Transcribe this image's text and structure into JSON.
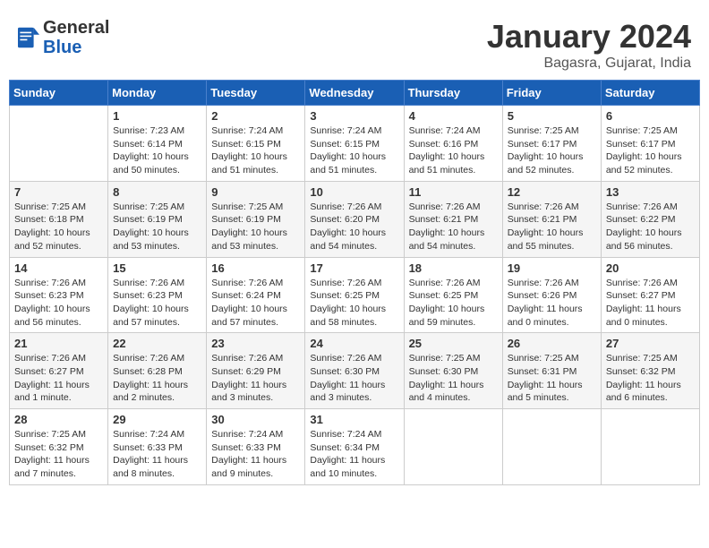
{
  "header": {
    "logo_general": "General",
    "logo_blue": "Blue",
    "month_title": "January 2024",
    "location": "Bagasra, Gujarat, India"
  },
  "days_of_week": [
    "Sunday",
    "Monday",
    "Tuesday",
    "Wednesday",
    "Thursday",
    "Friday",
    "Saturday"
  ],
  "weeks": [
    [
      {
        "num": "",
        "info": ""
      },
      {
        "num": "1",
        "info": "Sunrise: 7:23 AM\nSunset: 6:14 PM\nDaylight: 10 hours\nand 50 minutes."
      },
      {
        "num": "2",
        "info": "Sunrise: 7:24 AM\nSunset: 6:15 PM\nDaylight: 10 hours\nand 51 minutes."
      },
      {
        "num": "3",
        "info": "Sunrise: 7:24 AM\nSunset: 6:15 PM\nDaylight: 10 hours\nand 51 minutes."
      },
      {
        "num": "4",
        "info": "Sunrise: 7:24 AM\nSunset: 6:16 PM\nDaylight: 10 hours\nand 51 minutes."
      },
      {
        "num": "5",
        "info": "Sunrise: 7:25 AM\nSunset: 6:17 PM\nDaylight: 10 hours\nand 52 minutes."
      },
      {
        "num": "6",
        "info": "Sunrise: 7:25 AM\nSunset: 6:17 PM\nDaylight: 10 hours\nand 52 minutes."
      }
    ],
    [
      {
        "num": "7",
        "info": "Sunrise: 7:25 AM\nSunset: 6:18 PM\nDaylight: 10 hours\nand 52 minutes."
      },
      {
        "num": "8",
        "info": "Sunrise: 7:25 AM\nSunset: 6:19 PM\nDaylight: 10 hours\nand 53 minutes."
      },
      {
        "num": "9",
        "info": "Sunrise: 7:25 AM\nSunset: 6:19 PM\nDaylight: 10 hours\nand 53 minutes."
      },
      {
        "num": "10",
        "info": "Sunrise: 7:26 AM\nSunset: 6:20 PM\nDaylight: 10 hours\nand 54 minutes."
      },
      {
        "num": "11",
        "info": "Sunrise: 7:26 AM\nSunset: 6:21 PM\nDaylight: 10 hours\nand 54 minutes."
      },
      {
        "num": "12",
        "info": "Sunrise: 7:26 AM\nSunset: 6:21 PM\nDaylight: 10 hours\nand 55 minutes."
      },
      {
        "num": "13",
        "info": "Sunrise: 7:26 AM\nSunset: 6:22 PM\nDaylight: 10 hours\nand 56 minutes."
      }
    ],
    [
      {
        "num": "14",
        "info": "Sunrise: 7:26 AM\nSunset: 6:23 PM\nDaylight: 10 hours\nand 56 minutes."
      },
      {
        "num": "15",
        "info": "Sunrise: 7:26 AM\nSunset: 6:23 PM\nDaylight: 10 hours\nand 57 minutes."
      },
      {
        "num": "16",
        "info": "Sunrise: 7:26 AM\nSunset: 6:24 PM\nDaylight: 10 hours\nand 57 minutes."
      },
      {
        "num": "17",
        "info": "Sunrise: 7:26 AM\nSunset: 6:25 PM\nDaylight: 10 hours\nand 58 minutes."
      },
      {
        "num": "18",
        "info": "Sunrise: 7:26 AM\nSunset: 6:25 PM\nDaylight: 10 hours\nand 59 minutes."
      },
      {
        "num": "19",
        "info": "Sunrise: 7:26 AM\nSunset: 6:26 PM\nDaylight: 11 hours\nand 0 minutes."
      },
      {
        "num": "20",
        "info": "Sunrise: 7:26 AM\nSunset: 6:27 PM\nDaylight: 11 hours\nand 0 minutes."
      }
    ],
    [
      {
        "num": "21",
        "info": "Sunrise: 7:26 AM\nSunset: 6:27 PM\nDaylight: 11 hours\nand 1 minute."
      },
      {
        "num": "22",
        "info": "Sunrise: 7:26 AM\nSunset: 6:28 PM\nDaylight: 11 hours\nand 2 minutes."
      },
      {
        "num": "23",
        "info": "Sunrise: 7:26 AM\nSunset: 6:29 PM\nDaylight: 11 hours\nand 3 minutes."
      },
      {
        "num": "24",
        "info": "Sunrise: 7:26 AM\nSunset: 6:30 PM\nDaylight: 11 hours\nand 3 minutes."
      },
      {
        "num": "25",
        "info": "Sunrise: 7:25 AM\nSunset: 6:30 PM\nDaylight: 11 hours\nand 4 minutes."
      },
      {
        "num": "26",
        "info": "Sunrise: 7:25 AM\nSunset: 6:31 PM\nDaylight: 11 hours\nand 5 minutes."
      },
      {
        "num": "27",
        "info": "Sunrise: 7:25 AM\nSunset: 6:32 PM\nDaylight: 11 hours\nand 6 minutes."
      }
    ],
    [
      {
        "num": "28",
        "info": "Sunrise: 7:25 AM\nSunset: 6:32 PM\nDaylight: 11 hours\nand 7 minutes."
      },
      {
        "num": "29",
        "info": "Sunrise: 7:24 AM\nSunset: 6:33 PM\nDaylight: 11 hours\nand 8 minutes."
      },
      {
        "num": "30",
        "info": "Sunrise: 7:24 AM\nSunset: 6:33 PM\nDaylight: 11 hours\nand 9 minutes."
      },
      {
        "num": "31",
        "info": "Sunrise: 7:24 AM\nSunset: 6:34 PM\nDaylight: 11 hours\nand 10 minutes."
      },
      {
        "num": "",
        "info": ""
      },
      {
        "num": "",
        "info": ""
      },
      {
        "num": "",
        "info": ""
      }
    ]
  ]
}
